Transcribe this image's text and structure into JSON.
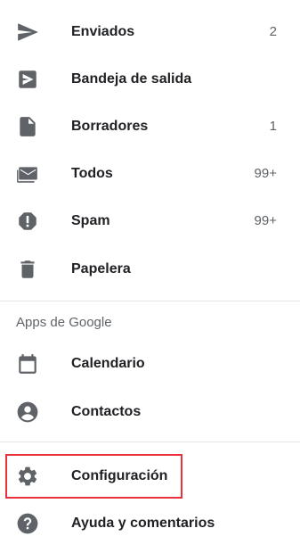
{
  "items": [
    {
      "label": "Enviados",
      "count": "2",
      "icon": "send-icon"
    },
    {
      "label": "Bandeja de salida",
      "count": "",
      "icon": "outbox-icon"
    },
    {
      "label": "Borradores",
      "count": "1",
      "icon": "draft-icon"
    },
    {
      "label": "Todos",
      "count": "99+",
      "icon": "all-mail-icon"
    },
    {
      "label": "Spam",
      "count": "99+",
      "icon": "spam-icon"
    },
    {
      "label": "Papelera",
      "count": "",
      "icon": "trash-icon"
    }
  ],
  "google_apps": {
    "header": "Apps de Google",
    "items": [
      {
        "label": "Calendario",
        "icon": "calendar-icon"
      },
      {
        "label": "Contactos",
        "icon": "contacts-icon"
      }
    ]
  },
  "settings": {
    "items": [
      {
        "label": "Configuración",
        "icon": "gear-icon"
      },
      {
        "label": "Ayuda y comentarios",
        "icon": "help-icon"
      }
    ]
  },
  "colors": {
    "icon": "#5f6368",
    "text": "#202124",
    "secondary": "#5f6368",
    "highlight_border": "#e8323c"
  }
}
